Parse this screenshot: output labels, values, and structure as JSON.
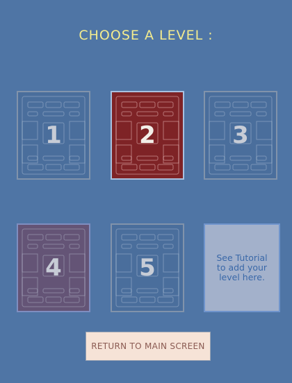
{
  "header": {
    "title": "CHOOSE A LEVEL :"
  },
  "levels": [
    {
      "label": "1",
      "state": "normal"
    },
    {
      "label": "2",
      "state": "selected"
    },
    {
      "label": "3",
      "state": "normal"
    },
    {
      "label": "4",
      "state": "normal"
    },
    {
      "label": "5",
      "state": "normal"
    }
  ],
  "tutorial_tile": {
    "text": "See Tutorial to add your level here."
  },
  "footer": {
    "return_label": "RETURN TO MAIN SCREEN"
  },
  "colors": {
    "background": "#4f75a5",
    "title": "#f4ec8e",
    "selected_tile": "#7e2326",
    "tile": "#4a6e9c",
    "tile_level4": "#645476",
    "tutorial_tile": "#a3b1cb",
    "button": "#f6e3d7"
  }
}
